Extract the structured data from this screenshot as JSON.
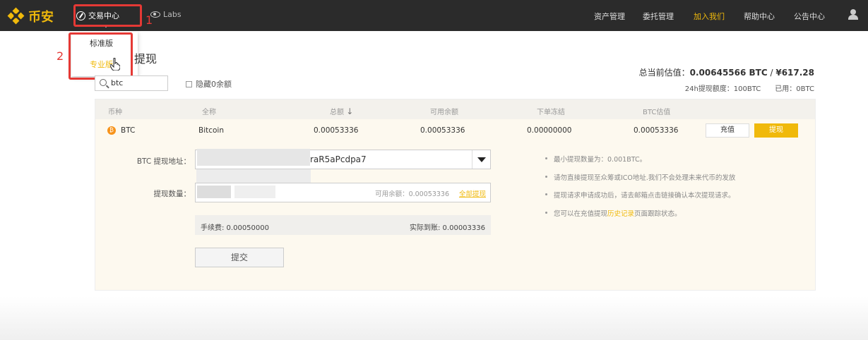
{
  "brand": {
    "name": "币安",
    "color": "#f0b90b"
  },
  "nav": {
    "trade_center": "交易中心",
    "labs": "Labs",
    "right_items": [
      "资产管理",
      "委托管理",
      "加入我们",
      "帮助中心",
      "公告中心"
    ],
    "active_item": "加入我们"
  },
  "dropdown": {
    "items": [
      "标准版",
      "专业版"
    ],
    "highlighted": "专业版"
  },
  "annotations": [
    "1",
    "2"
  ],
  "page": {
    "title": "提现"
  },
  "filters": {
    "search_value": "btc",
    "hide_zero_label": "隐藏0余额",
    "hide_zero_checked": false
  },
  "estimate": {
    "label": "总当前估值：",
    "btc": "0.00645566 BTC",
    "sep": " / ",
    "cny": "¥617.28",
    "quota": "24h提现额度：100BTC　　已用：0BTC"
  },
  "table": {
    "headers": [
      "币种",
      "全称",
      "总额",
      "可用余额",
      "下单冻结",
      "BTC估值"
    ],
    "sort_indicator": "↓",
    "row": {
      "coin": "BTC",
      "name": "Bitcoin",
      "total": "0.00053336",
      "available": "0.00053336",
      "frozen": "0.00000000",
      "btc_value": "0.00053336",
      "deposit_label": "充值",
      "withdraw_label": "提现"
    }
  },
  "withdraw_form": {
    "address_label": "BTC 提现地址：",
    "address_value": "raR5aPcdpa7",
    "amount_label": "提现数量：",
    "available_text": "可用余额：0.00053336",
    "all_label": "全部提现",
    "fee_text": "手续费: 0.00050000",
    "actual_text": "实际到账: 0.00003336",
    "submit_label": "提交"
  },
  "notes": {
    "n1": "最小提现数量为：0.001BTC。",
    "n2": "请勿直接提现至众筹或ICO地址.我们不会处理未来代币的发放",
    "n3": "提现请求申请成功后，请去邮箱点击链接确认本次提现请求。",
    "n4_pre": "您可以在充值提现",
    "n4_link": "历史记录",
    "n4_post": "页面跟踪状态。"
  }
}
